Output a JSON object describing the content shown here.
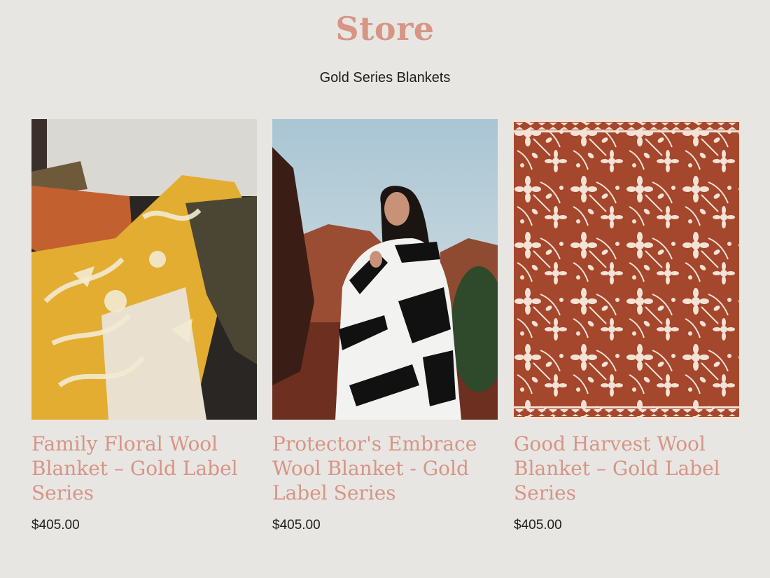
{
  "header": {
    "title": "Store",
    "subtitle": "Gold Series Blankets"
  },
  "products": [
    {
      "name": "Family Floral Wool Blanket – Gold Label Series",
      "price": "$405.00",
      "image": "gold-floral-blanket-on-sofa"
    },
    {
      "name": "Protector's Embrace Wool Blanket - Gold Label Series",
      "price": "$405.00",
      "image": "woman-wrapped-in-black-white-blanket"
    },
    {
      "name": "Good Harvest Wool Blanket – Gold Label Series",
      "price": "$405.00",
      "image": "rust-floral-pattern-blanket"
    }
  ],
  "colors": {
    "background": "#e8e6e3",
    "accent": "#d69585",
    "text": "#1e1e1e",
    "gold": "#e2ad30",
    "rust": "#a5472d"
  }
}
